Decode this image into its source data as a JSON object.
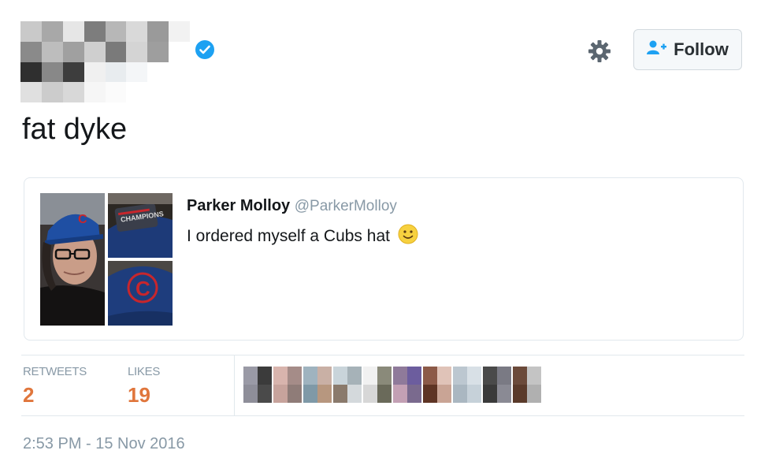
{
  "tweet": {
    "text": "fat dyke",
    "timestamp": "2:53 PM - 15 Nov 2016"
  },
  "header": {
    "follow_label": "Follow"
  },
  "quoted_tweet": {
    "name": "Parker Molloy",
    "handle": "@ParkerMolloy",
    "text": "I ordered myself a Cubs hat",
    "emoji": "🙂"
  },
  "stats": {
    "retweets_label": "RETWEETS",
    "retweets_count": "2",
    "likes_label": "LIKES",
    "likes_count": "19"
  },
  "colors": {
    "verified": "#1da1f2",
    "stat_value": "#e0763c",
    "muted": "#8899a6",
    "border": "#e1e8ed"
  },
  "icons": {
    "verified": "verified-badge-icon",
    "settings": "gear-icon",
    "follow": "add-user-icon"
  }
}
